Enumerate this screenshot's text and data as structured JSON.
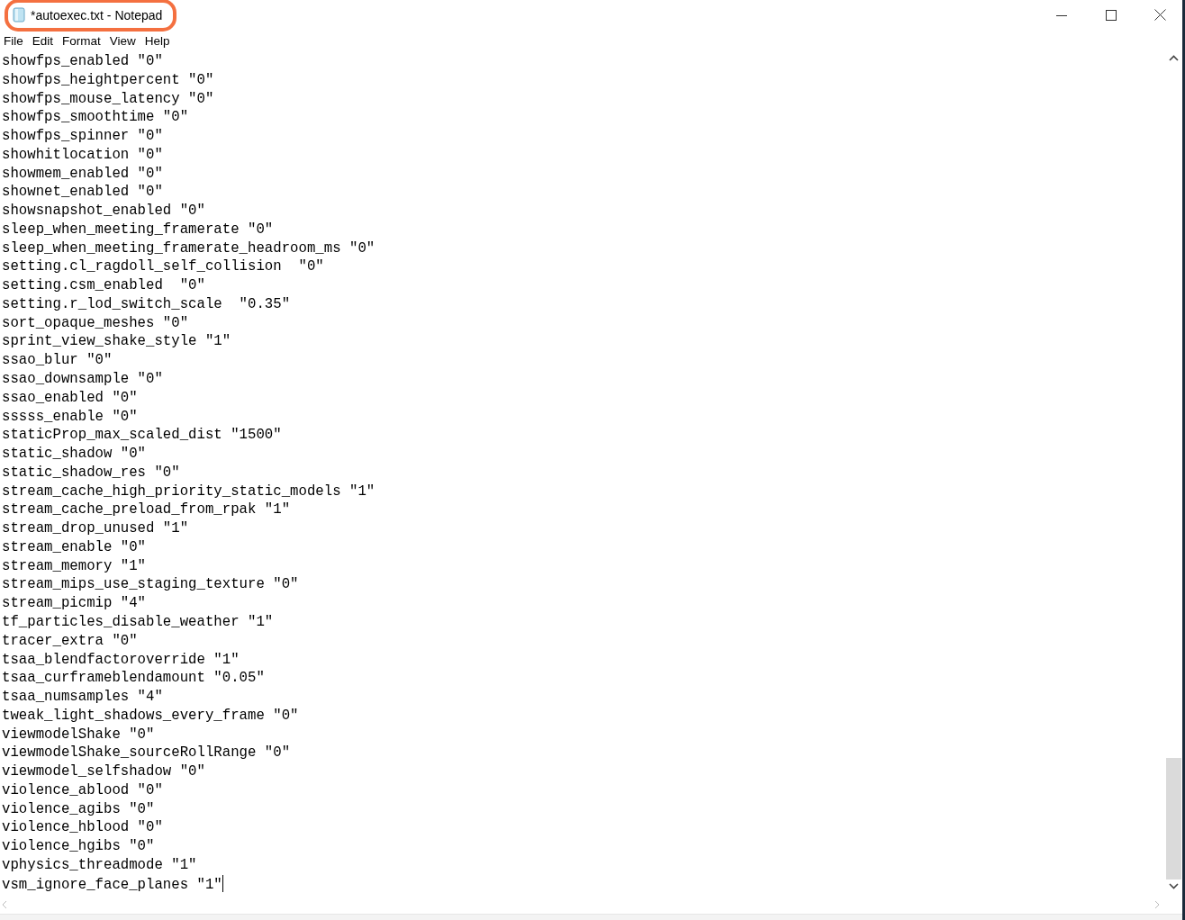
{
  "window": {
    "title": "*autoexec.txt - Notepad",
    "title_highlighted": true
  },
  "menu": [
    "File",
    "Edit",
    "Format",
    "View",
    "Help"
  ],
  "editor": {
    "lines": [
      "showfps_enabled \"0\"",
      "showfps_heightpercent \"0\"",
      "showfps_mouse_latency \"0\"",
      "showfps_smoothtime \"0\"",
      "showfps_spinner \"0\"",
      "showhitlocation \"0\"",
      "showmem_enabled \"0\"",
      "shownet_enabled \"0\"",
      "showsnapshot_enabled \"0\"",
      "sleep_when_meeting_framerate \"0\"",
      "sleep_when_meeting_framerate_headroom_ms \"0\"",
      "setting.cl_ragdoll_self_collision  \"0\"",
      "setting.csm_enabled  \"0\"",
      "setting.r_lod_switch_scale  \"0.35\"",
      "sort_opaque_meshes \"0\"",
      "sprint_view_shake_style \"1\"",
      "ssao_blur \"0\"",
      "ssao_downsample \"0\"",
      "ssao_enabled \"0\"",
      "sssss_enable \"0\"",
      "staticProp_max_scaled_dist \"1500\"",
      "static_shadow \"0\"",
      "static_shadow_res \"0\"",
      "stream_cache_high_priority_static_models \"1\"",
      "stream_cache_preload_from_rpak \"1\"",
      "stream_drop_unused \"1\"",
      "stream_enable \"0\"",
      "stream_memory \"1\"",
      "stream_mips_use_staging_texture \"0\"",
      "stream_picmip \"4\"",
      "tf_particles_disable_weather \"1\"",
      "tracer_extra \"0\"",
      "tsaa_blendfactoroverride \"1\"",
      "tsaa_curframeblendamount \"0.05\"",
      "tsaa_numsamples \"4\"",
      "tweak_light_shadows_every_frame \"0\"",
      "viewmodelShake \"0\"",
      "viewmodelShake_sourceRollRange \"0\"",
      "viewmodel_selfshadow \"0\"",
      "violence_ablood \"0\"",
      "violence_agibs \"0\"",
      "violence_hblood \"0\"",
      "violence_hgibs \"0\"",
      "vphysics_threadmode \"1\"",
      "vsm_ignore_face_planes \"1\""
    ]
  }
}
